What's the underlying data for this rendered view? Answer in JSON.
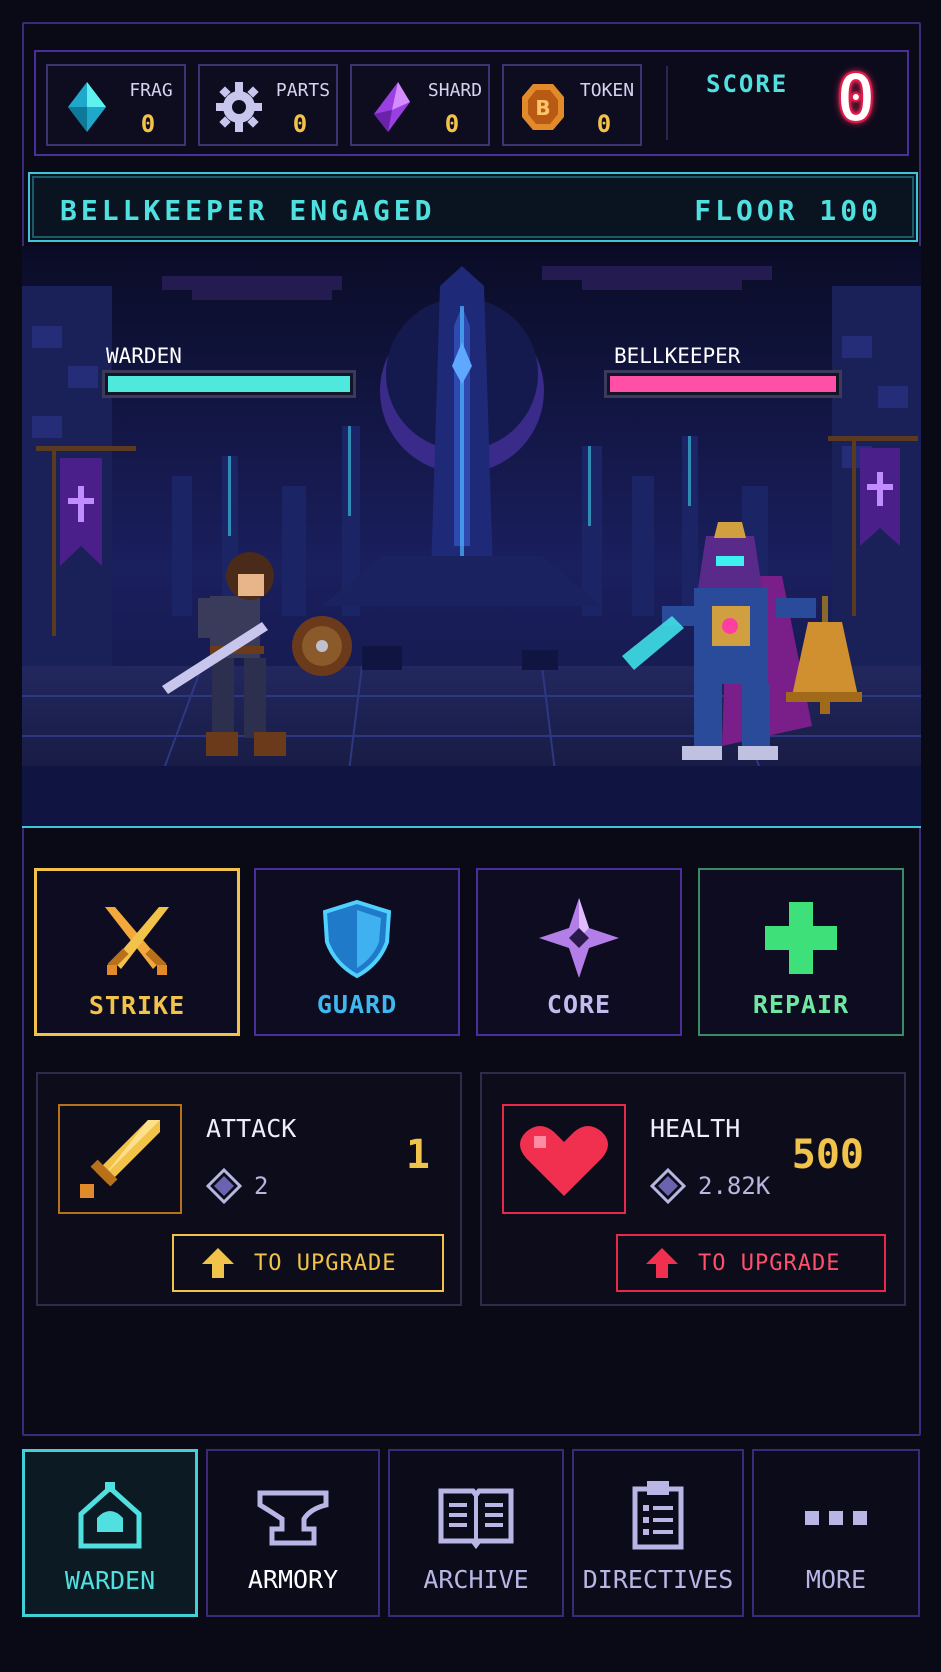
{
  "resources": [
    {
      "label": "FRAG",
      "value": "0",
      "icon": "cyan-crystal-icon"
    },
    {
      "label": "PARTS",
      "value": "0",
      "icon": "gear-icon"
    },
    {
      "label": "SHARD",
      "value": "0",
      "icon": "purple-shard-icon"
    },
    {
      "label": "TOKEN",
      "value": "0",
      "icon": "bronze-token-icon"
    }
  ],
  "score": {
    "label": "SCORE",
    "value": "0"
  },
  "status": {
    "encounter": "BELLKEEPER ENGAGED",
    "floor": "FLOOR 100"
  },
  "battle": {
    "player": {
      "name": "WARDEN",
      "hp_fraction": 1.0,
      "color": "#4fe8dc"
    },
    "enemy": {
      "name": "BELLKEEPER",
      "hp_fraction": 1.0,
      "color": "#ff4fa7"
    }
  },
  "actions": [
    {
      "label": "STRIKE",
      "icon": "crossed-swords-icon",
      "color": "#f2c34a",
      "selected": true
    },
    {
      "label": "GUARD",
      "icon": "shield-icon",
      "color": "#3fb8f0"
    },
    {
      "label": "CORE",
      "icon": "four-point-star-icon",
      "color": "#c79cf2"
    },
    {
      "label": "REPAIR",
      "icon": "plus-icon",
      "color": "#4fe08a"
    }
  ],
  "stats": {
    "attack": {
      "label": "ATTACK",
      "cost": "2",
      "value": "1",
      "upgrade_label": "TO UPGRADE",
      "icon": "sword-icon"
    },
    "health": {
      "label": "HEALTH",
      "cost": "2.82K",
      "value": "500",
      "upgrade_label": "TO UPGRADE",
      "icon": "heart-icon"
    }
  },
  "nav": [
    {
      "label": "WARDEN",
      "icon": "house-helmet-icon",
      "active": true
    },
    {
      "label": "ARMORY",
      "icon": "anvil-icon"
    },
    {
      "label": "ARCHIVE",
      "icon": "open-book-icon"
    },
    {
      "label": "DIRECTIVES",
      "icon": "clipboard-icon"
    },
    {
      "label": "MORE",
      "icon": "ellipsis-icon"
    }
  ],
  "colors": {
    "accent_cyan": "#4fe0df",
    "accent_gold": "#f2c34a",
    "accent_red": "#e8284a",
    "frame_purple": "#4a2f9a"
  }
}
